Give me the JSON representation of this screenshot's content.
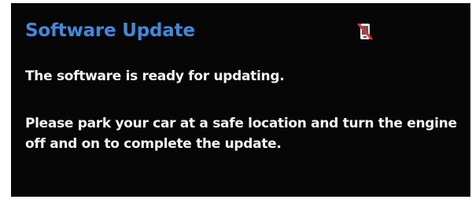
{
  "screen": {
    "title": "Software Update",
    "status_icon": "phone-disconnected-icon",
    "message_ready": "The software is ready for updating.",
    "message_instruction": "Please park your car at a safe location and turn the engine off and on to complete the update."
  },
  "colors": {
    "background": "#060606",
    "title": "#3d8be0",
    "text": "#f4f4f4",
    "icon_slash": "#e03030"
  }
}
